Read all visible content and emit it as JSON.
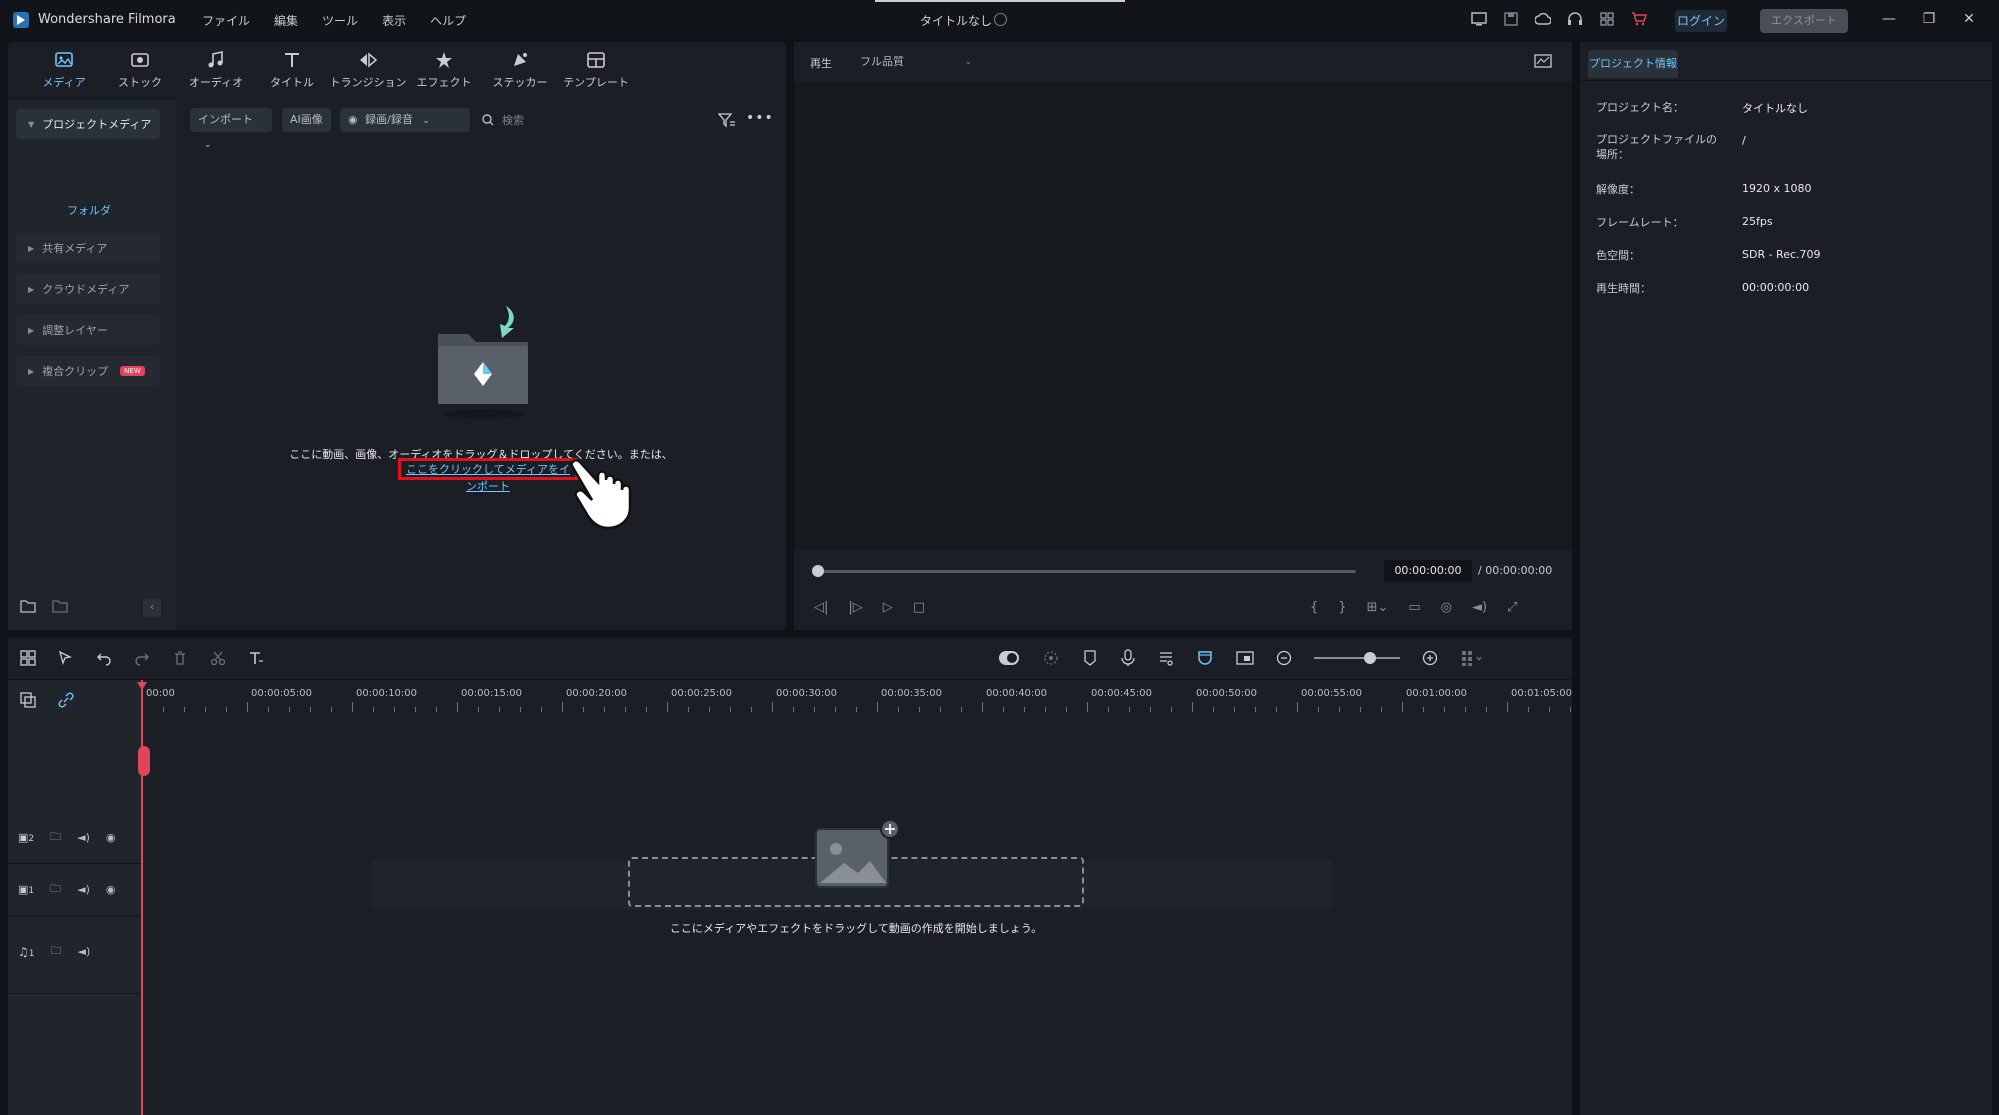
{
  "titlebar": {
    "app_name": "Wondershare Filmora",
    "menu": [
      "ファイル",
      "編集",
      "ツール",
      "表示",
      "ヘルプ"
    ],
    "project_title": "タイトルなし",
    "login": "ログイン",
    "export": "エクスポート"
  },
  "media_tabs": [
    {
      "label": "メディア",
      "icon": "media-icon",
      "active": true
    },
    {
      "label": "ストック",
      "icon": "stock-icon"
    },
    {
      "label": "オーディオ",
      "icon": "audio-icon"
    },
    {
      "label": "タイトル",
      "icon": "title-icon"
    },
    {
      "label": "トランジション",
      "icon": "transition-icon"
    },
    {
      "label": "エフェクト",
      "icon": "effect-icon"
    },
    {
      "label": "ステッカー",
      "icon": "sticker-icon"
    },
    {
      "label": "テンプレート",
      "icon": "template-icon"
    }
  ],
  "sidebar": {
    "project_media": "プロジェクトメディア",
    "folder": "フォルダ",
    "items": [
      {
        "label": "共有メディア"
      },
      {
        "label": "クラウドメディア"
      },
      {
        "label": "調整レイヤー"
      },
      {
        "label": "複合クリップ",
        "badge": "NEW"
      }
    ]
  },
  "media_toolbar": {
    "import": "インポート",
    "ai_image": "AI画像",
    "record": "録画/録音",
    "search_placeholder": "検索"
  },
  "dropzone": {
    "text": "ここに動画、画像、オーディオをドラッグ＆ドロップしてください。または、",
    "link": "ここをクリックしてメディアをインポート"
  },
  "preview": {
    "play_label": "再生",
    "quality": "フル品質",
    "timecode": "00:00:00:00",
    "duration": "/ 00:00:00:00"
  },
  "info_panel": {
    "tab": "プロジェクト情報",
    "rows": [
      {
        "key": "プロジェクト名：",
        "value": "タイトルなし"
      },
      {
        "key": "プロジェクトファイルの場所：",
        "value": "/"
      },
      {
        "key": "解像度：",
        "value": "1920 x 1080"
      },
      {
        "key": "フレームレート：",
        "value": "25fps"
      },
      {
        "key": "色空間：",
        "value": "SDR - Rec.709"
      },
      {
        "key": "再生時間：",
        "value": "00:00:00:00"
      }
    ]
  },
  "timeline": {
    "ruler": [
      "00:00",
      "00:00:05:00",
      "00:00:10:00",
      "00:00:15:00",
      "00:00:20:00",
      "00:00:25:00",
      "00:00:30:00",
      "00:00:35:00",
      "00:00:40:00",
      "00:00:45:00",
      "00:00:50:00",
      "00:00:55:00",
      "00:01:00:00",
      "00:01:05:00"
    ],
    "tracks": [
      {
        "number": "2",
        "type": "video"
      },
      {
        "number": "1",
        "type": "video"
      },
      {
        "number": "1",
        "type": "audio"
      }
    ],
    "drop_hint": "ここにメディアやエフェクトをドラッグして動画の作成を開始しましょう。"
  },
  "colors": {
    "accent": "#6cc6ff",
    "highlight": "#e2111b",
    "playhead": "#e2445b"
  }
}
